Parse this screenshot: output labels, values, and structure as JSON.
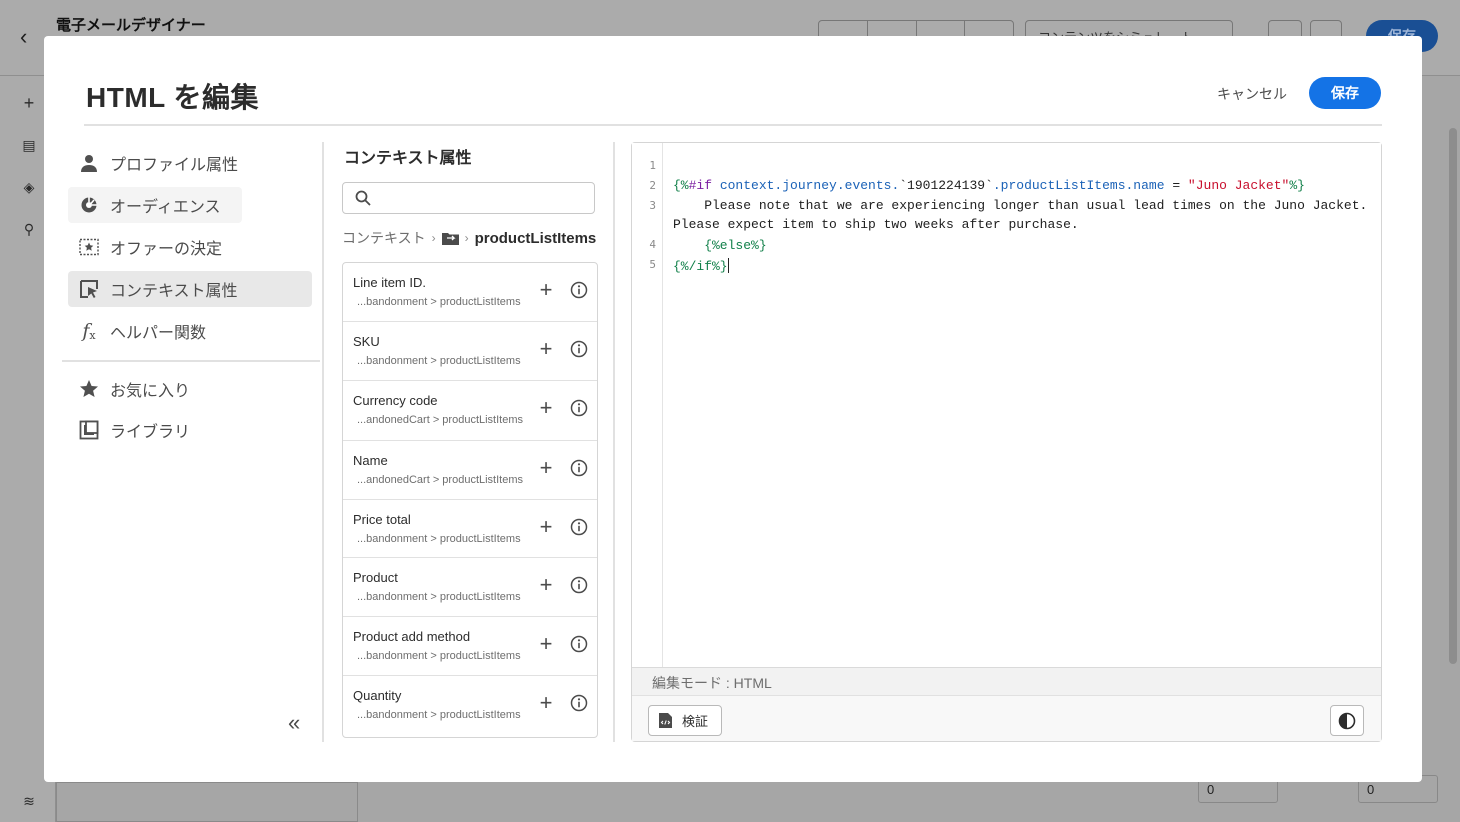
{
  "background_app": {
    "title": "電子メールデザイナー",
    "simulate_label": "コンテンツをシミュレート",
    "save_label": "保存",
    "field_values": [
      "0",
      "0"
    ]
  },
  "modal": {
    "title": "HTML を編集",
    "cancel_label": "キャンセル",
    "save_label": "保存"
  },
  "nav": {
    "items": [
      {
        "label": "プロファイル属性",
        "icon": "person-icon"
      },
      {
        "label": "オーディエンス",
        "icon": "audience-icon"
      },
      {
        "label": "オファーの決定",
        "icon": "offer-icon"
      },
      {
        "label": "コンテキスト属性",
        "icon": "context-cursor-icon"
      },
      {
        "label": "ヘルパー関数",
        "icon": "function-icon"
      }
    ],
    "secondary": [
      {
        "label": "お気に入り",
        "icon": "star-icon"
      },
      {
        "label": "ライブラリ",
        "icon": "library-icon"
      }
    ],
    "collapse_icon": "double-chevron-left-icon"
  },
  "context_panel": {
    "title": "コンテキスト属性",
    "search": {
      "placeholder": "",
      "value": ""
    },
    "breadcrumb": {
      "root": "コンテキスト",
      "current": "productListItems"
    },
    "items": [
      {
        "name": "Line item ID.",
        "path": "...bandonment > productListItems"
      },
      {
        "name": "SKU",
        "path": "...bandonment > productListItems"
      },
      {
        "name": "Currency code",
        "path": "...andonedCart > productListItems"
      },
      {
        "name": "Name",
        "path": "...andonedCart > productListItems"
      },
      {
        "name": "Price total",
        "path": "...bandonment > productListItems"
      },
      {
        "name": "Product",
        "path": "...bandonment > productListItems"
      },
      {
        "name": "Product add method",
        "path": "...bandonment > productListItems"
      },
      {
        "name": "Quantity",
        "path": "...bandonment > productListItems"
      }
    ]
  },
  "editor": {
    "line_numbers": [
      "1",
      "2",
      "3",
      "4",
      "5"
    ],
    "line2": {
      "open": "{%",
      "keyword": "#if",
      "path": " context.journey.events.",
      "event_id": "`1901224139`",
      "attr": ".productListItems.name",
      "op": " = ",
      "str": "\"Juno Jacket\"",
      "close": "%}"
    },
    "line3a": "    Please note that we are experiencing longer than usual lead times on the Juno Jacket.",
    "line3b": "Please expect item to ship two weeks after purchase.",
    "line4": "    {%else%}",
    "line5": "{%/if%}",
    "mode_label": "編集モード : HTML",
    "validate_label": "検証"
  },
  "colors": {
    "accent": "#1473e6",
    "keyword_green": "#12804a",
    "keyword_purple": "#7b1fa2",
    "path_blue": "#1b62b7",
    "string_red": "#c8102e"
  }
}
